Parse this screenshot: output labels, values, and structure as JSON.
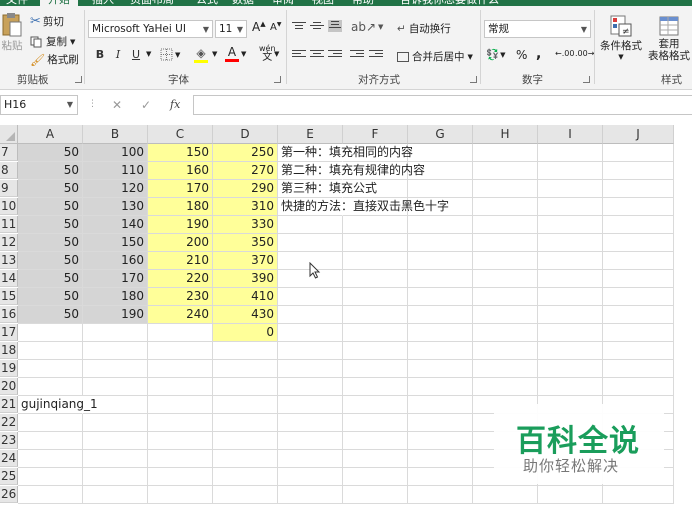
{
  "tabs": [
    "文件",
    "开始",
    "插入",
    "页面布局",
    "公式",
    "数据",
    "审阅",
    "视图",
    "帮助",
    "告诉我你想要做什么"
  ],
  "ribbon": {
    "clipboard": {
      "paste": "粘贴",
      "cut": "剪切",
      "copy": "复制",
      "format_painter": "格式刷",
      "group_label": "剪贴板"
    },
    "font": {
      "font_name": "Microsoft YaHei UI",
      "font_size": "11",
      "grow": "A",
      "shrink": "A",
      "bold": "B",
      "italic": "I",
      "underline": "U",
      "phonetic": "wén",
      "group_label": "字体",
      "highlight_color": "#ffff00",
      "font_color": "#ff0000"
    },
    "alignment": {
      "wrap_text": "自动换行",
      "merge_center": "合并后居中",
      "group_label": "对齐方式"
    },
    "number": {
      "format": "常规",
      "percent": "%",
      "comma": ",",
      "inc_decimal": ".00",
      "dec_decimal": ".00",
      "group_label": "数字"
    },
    "styles": {
      "conditional_format": "条件格式",
      "format_as_table": "套用\n表格格式",
      "group_label": "样式"
    }
  },
  "formula_bar": {
    "name_box": "H16",
    "cancel_glyph": "✕",
    "enter_glyph": "✓",
    "fx_glyph": "fx",
    "formula": ""
  },
  "columns": [
    "A",
    "B",
    "C",
    "D",
    "E",
    "F",
    "G",
    "H",
    "I",
    "J"
  ],
  "rows": [
    {
      "n": "7",
      "A": "50",
      "B": "100",
      "C": "150",
      "D": "250",
      "E": "第一种：填充相同的内容"
    },
    {
      "n": "8",
      "A": "50",
      "B": "110",
      "C": "160",
      "D": "270",
      "E": "第二种：填充有规律的内容"
    },
    {
      "n": "9",
      "A": "50",
      "B": "120",
      "C": "170",
      "D": "290",
      "E": "第三种：填充公式"
    },
    {
      "n": "10",
      "A": "50",
      "B": "130",
      "C": "180",
      "D": "310",
      "E": "快捷的方法：直接双击黑色十字"
    },
    {
      "n": "11",
      "A": "50",
      "B": "140",
      "C": "190",
      "D": "330",
      "E": ""
    },
    {
      "n": "12",
      "A": "50",
      "B": "150",
      "C": "200",
      "D": "350",
      "E": ""
    },
    {
      "n": "13",
      "A": "50",
      "B": "160",
      "C": "210",
      "D": "370",
      "E": ""
    },
    {
      "n": "14",
      "A": "50",
      "B": "170",
      "C": "220",
      "D": "390",
      "E": ""
    },
    {
      "n": "15",
      "A": "50",
      "B": "180",
      "C": "230",
      "D": "410",
      "E": ""
    },
    {
      "n": "16",
      "A": "50",
      "B": "190",
      "C": "240",
      "D": "430",
      "E": ""
    },
    {
      "n": "17",
      "A": "",
      "B": "",
      "C": "",
      "D": "0",
      "E": ""
    },
    {
      "n": "18",
      "A": "",
      "B": "",
      "C": "",
      "D": "",
      "E": ""
    },
    {
      "n": "19",
      "A": "",
      "B": "",
      "C": "",
      "D": "",
      "E": ""
    },
    {
      "n": "20",
      "A": "",
      "B": "",
      "C": "",
      "D": "",
      "E": ""
    },
    {
      "n": "21",
      "A": "gujinqiang_1",
      "B": "",
      "C": "",
      "D": "",
      "E": ""
    },
    {
      "n": "22",
      "A": "",
      "B": "",
      "C": "",
      "D": "",
      "E": ""
    },
    {
      "n": "23",
      "A": "",
      "B": "",
      "C": "",
      "D": "",
      "E": ""
    },
    {
      "n": "24",
      "A": "",
      "B": "",
      "C": "",
      "D": "",
      "E": ""
    },
    {
      "n": "25",
      "A": "",
      "B": "",
      "C": "",
      "D": "",
      "E": ""
    },
    {
      "n": "26",
      "A": "",
      "B": "",
      "C": "",
      "D": "",
      "E": ""
    }
  ],
  "highlight_color": "#ffff99",
  "selection_color": "#d5d5d5",
  "watermark": {
    "title": "百科全说",
    "subtitle": "助你轻松解决"
  }
}
